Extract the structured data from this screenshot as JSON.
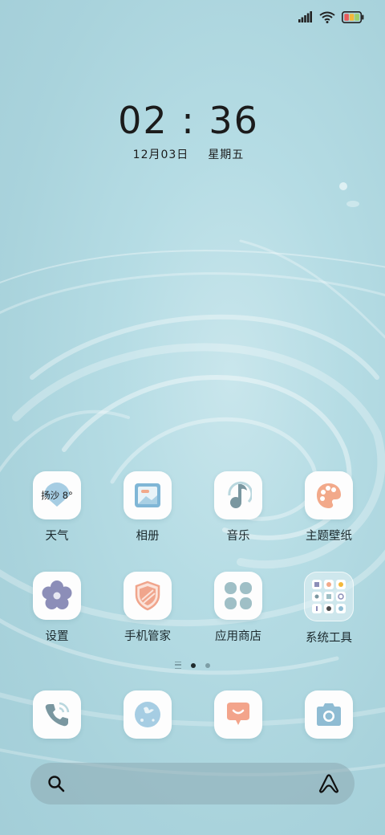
{
  "status_bar": {
    "signal_icon": "signal-bars-icon",
    "wifi_icon": "wifi-icon",
    "battery_icon": "battery-icon"
  },
  "lockclock": {
    "time": "02 : 36",
    "date": "12月03日",
    "weekday": "星期五"
  },
  "apps_row1": [
    {
      "label": "天气",
      "icon": "weather-icon",
      "badge_text": "扬沙 8°"
    },
    {
      "label": "相册",
      "icon": "gallery-icon"
    },
    {
      "label": "音乐",
      "icon": "music-icon"
    },
    {
      "label": "主题壁纸",
      "icon": "themes-palette-icon"
    }
  ],
  "apps_row2": [
    {
      "label": "设置",
      "icon": "settings-flower-icon"
    },
    {
      "label": "手机管家",
      "icon": "security-shield-icon"
    },
    {
      "label": "应用商店",
      "icon": "app-store-icon"
    },
    {
      "label": "系统工具",
      "icon": "system-tools-folder-icon"
    }
  ],
  "page_indicator": {
    "current_page": 2,
    "total_pages": 3
  },
  "dock": [
    {
      "icon": "phone-icon"
    },
    {
      "icon": "browser-icon"
    },
    {
      "icon": "messages-icon"
    },
    {
      "icon": "camera-icon"
    }
  ],
  "search_bar": {
    "search_icon": "search-icon",
    "assistant_icon": "assistant-icon"
  },
  "colors": {
    "weather": "#a6cde3",
    "gallery": "#7fb6d6",
    "music": "#7a97a0",
    "themes": "#f2a98a",
    "settings": "#8c8eb8",
    "security": "#f0a58c",
    "app_store": "#9fbfc6",
    "messages": "#f3a48b",
    "camera": "#8fbcd3"
  }
}
